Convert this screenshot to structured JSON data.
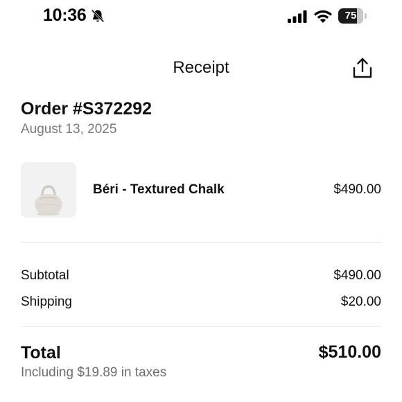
{
  "status_bar": {
    "time": "10:36",
    "battery": "75",
    "battery_level": 0.75
  },
  "header": {
    "title": "Receipt"
  },
  "order": {
    "title": "Order #S372292",
    "date": "August 13, 2025"
  },
  "items": [
    {
      "name": "Béri - Textured Chalk",
      "price": "$490.00"
    }
  ],
  "summary": {
    "subtotal_label": "Subtotal",
    "subtotal_value": "$490.00",
    "shipping_label": "Shipping",
    "shipping_value": "$20.00",
    "total_label": "Total",
    "total_value": "$510.00",
    "tax_note": "Including $19.89 in taxes"
  },
  "icons": {
    "silent": "bell-slash-icon",
    "signal": "cellular-signal-icon",
    "wifi": "wifi-icon",
    "share": "share-icon"
  }
}
